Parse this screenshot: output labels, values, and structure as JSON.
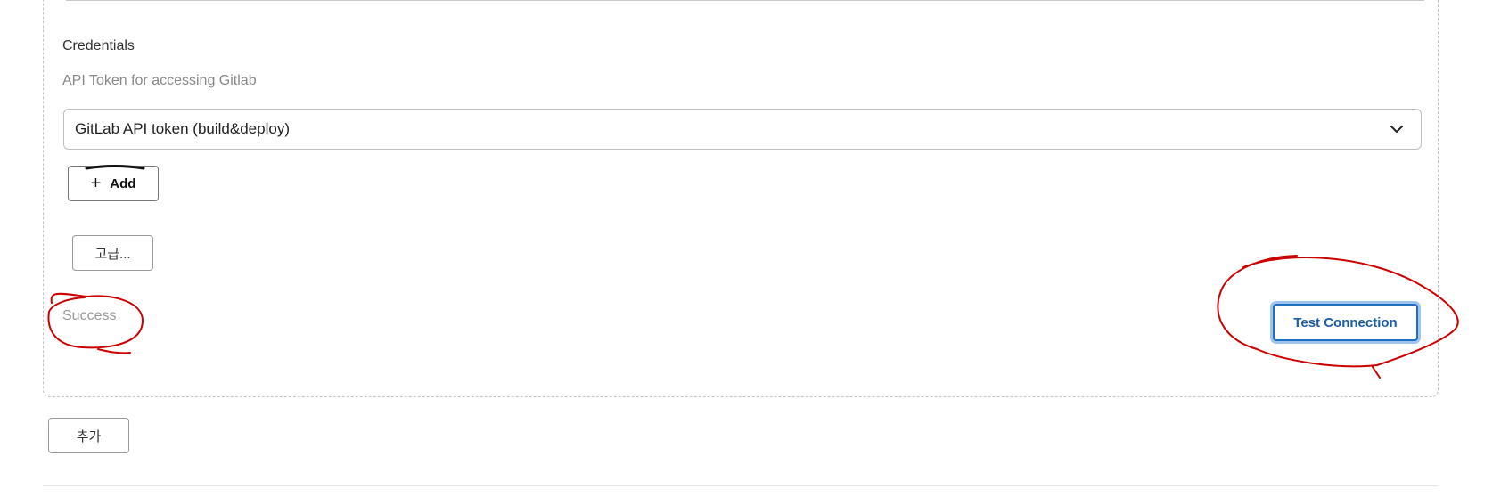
{
  "credentials": {
    "label": "Credentials",
    "description": "API Token for accessing Gitlab",
    "selected_value": "GitLab API token (build&deploy)",
    "add_label": "Add"
  },
  "advanced_label": "고급...",
  "status_text": "Success",
  "test_connection_label": "Test Connection",
  "add_more_label": "추가",
  "icons": {
    "dropdown": "chevron-down-icon",
    "add": "plus-icon"
  },
  "colors": {
    "annotation": "#cc0000",
    "primary": "#1f6fc5"
  }
}
